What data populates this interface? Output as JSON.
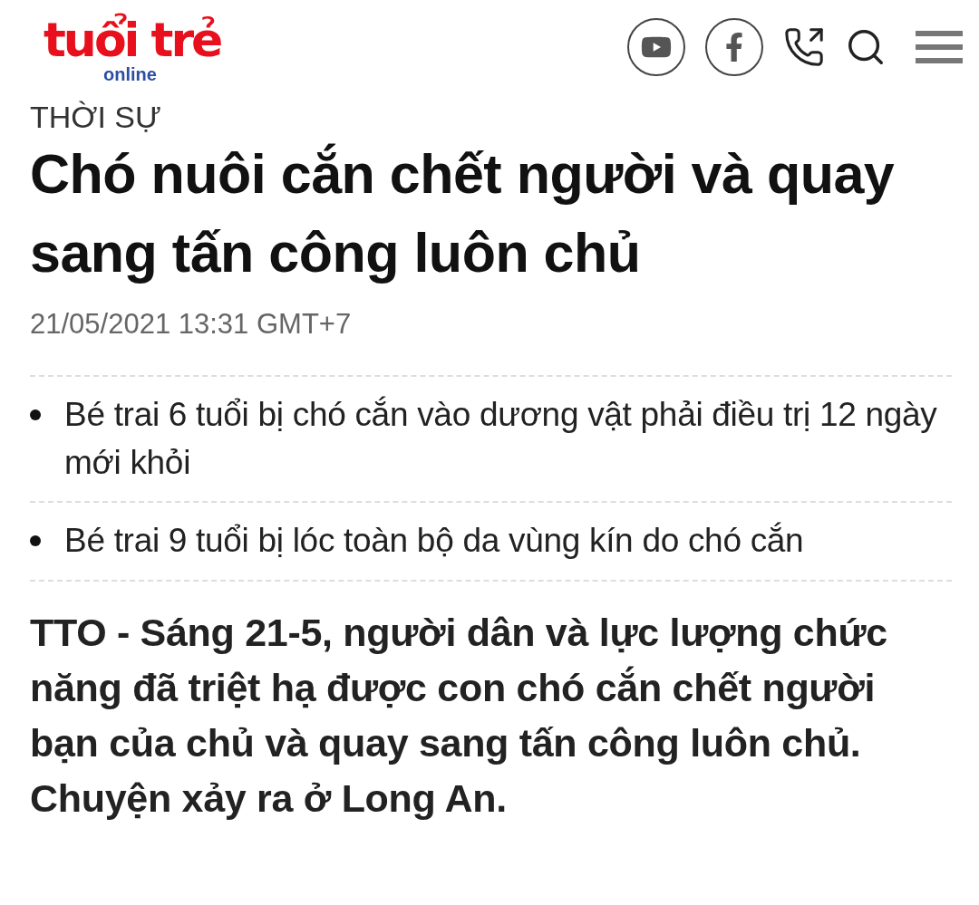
{
  "header": {
    "logo": {
      "main": "tuổi trẻ",
      "sub": "online"
    }
  },
  "article": {
    "category": "THỜI SỰ",
    "title": "Chó nuôi cắn chết người và quay sang tấn công luôn chủ",
    "date": "21/05/2021 13:31 GMT+7",
    "related": [
      {
        "text": "Bé trai 6 tuổi bị chó cắn vào dương vật phải điều trị 12 ngày mới khỏi"
      },
      {
        "text": "Bé trai 9 tuổi bị lóc toàn bộ da vùng kín do chó cắn"
      }
    ],
    "lead": "TTO - Sáng 21-5, người dân và lực lượng chức năng đã triệt hạ được con chó cắn chết người bạn của chủ và quay sang tấn công luôn chủ. Chuyện xảy ra ở Long An."
  }
}
